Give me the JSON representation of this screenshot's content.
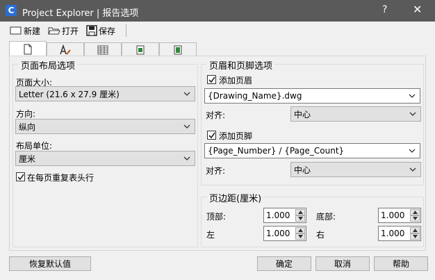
{
  "window": {
    "title": "Project Explorer | 报告选项",
    "help": "?",
    "close": "✕"
  },
  "toolbar": {
    "new": "新建",
    "open": "打开",
    "save": "保存"
  },
  "left_group": {
    "title": "页面布局选项",
    "page_size_label": "页面大小:",
    "page_size_value": "Letter (21.6 x 27.9 厘米)",
    "orientation_label": "方向:",
    "orientation_value": "纵向",
    "units_label": "布局单位:",
    "units_value": "厘米",
    "repeat_header_label": "在每页重复表头行",
    "repeat_header_checked": true
  },
  "header_footer": {
    "title": "页眉和页脚选项",
    "add_header_label": "添加页眉",
    "add_header_checked": true,
    "header_value": "{Drawing_Name}.dwg",
    "header_align_label": "对齐:",
    "header_align_value": "中心",
    "add_footer_label": "添加页脚",
    "add_footer_checked": true,
    "footer_value": "{Page_Number} / {Page_Count}",
    "footer_align_label": "对齐:",
    "footer_align_value": "中心"
  },
  "margins": {
    "title": "页边距(厘米)",
    "top_label": "顶部:",
    "top_value": "1.000",
    "bottom_label": "底部:",
    "bottom_value": "1.000",
    "left_label": "左",
    "left_value": "1.000",
    "right_label": "右",
    "right_value": "1.000"
  },
  "buttons": {
    "restore": "恢复默认值",
    "ok": "确定",
    "cancel": "取消",
    "help": "帮助"
  }
}
